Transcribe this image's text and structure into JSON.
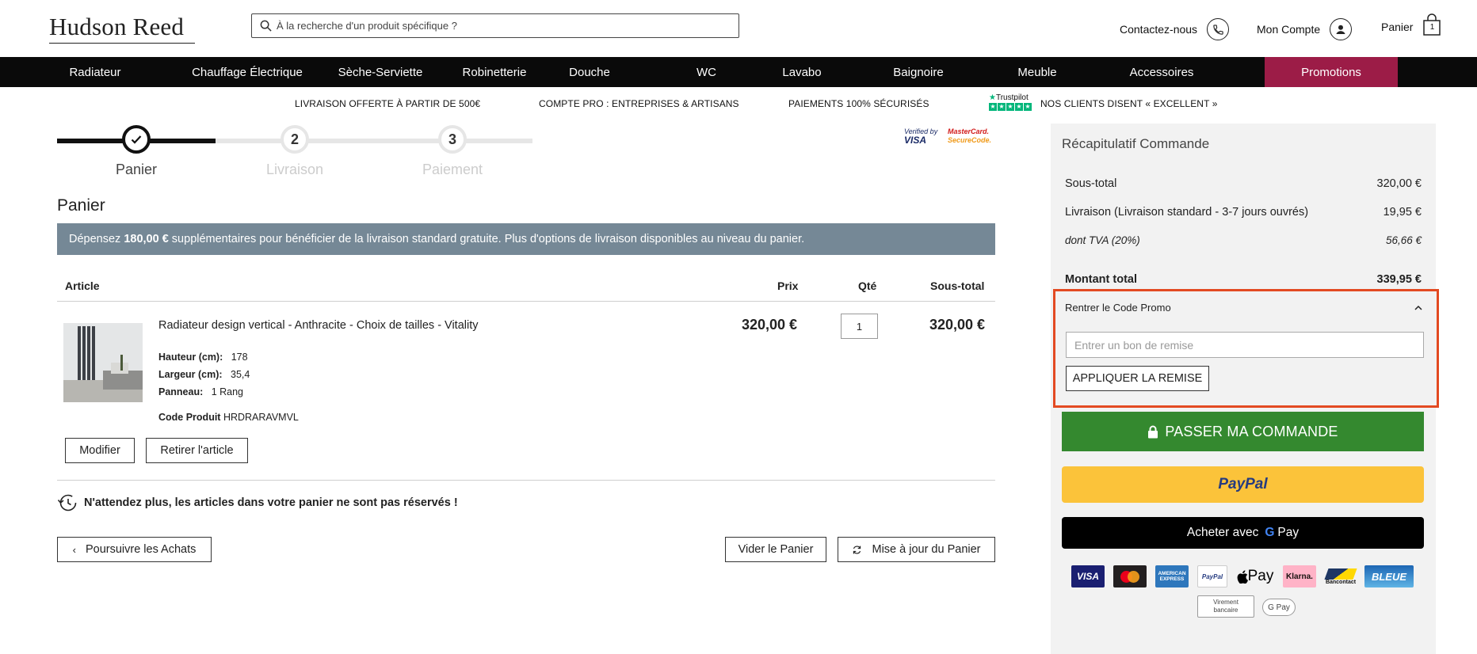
{
  "header": {
    "logo": "Hudson Reed",
    "search_placeholder": "À la recherche d'un produit spécifique ?",
    "contact_label": "Contactez-nous",
    "account_label": "Mon Compte",
    "cart_label": "Panier",
    "cart_count": "1"
  },
  "nav": {
    "items": [
      "Radiateur",
      "Chauffage Électrique",
      "Sèche-Serviette",
      "Robinetterie",
      "Douche",
      "WC",
      "Lavabo",
      "Baignoire",
      "Meuble",
      "Accessoires",
      "Promotions"
    ]
  },
  "usp": {
    "delivery": "LIVRAISON OFFERTE À PARTIR DE 500€",
    "pro": "COMPTE PRO : ENTREPRISES & ARTISANS",
    "payments": "PAIEMENTS 100% SÉCURISÉS",
    "trustpilot": "Trustpilot",
    "reviews": "NOS CLIENTS DISENT « EXCELLENT »"
  },
  "steps": [
    {
      "number": "",
      "label": "Panier"
    },
    {
      "number": "2",
      "label": "Livraison"
    },
    {
      "number": "3",
      "label": "Paiement"
    }
  ],
  "badges": {
    "verified_1": "Verified by",
    "verified_2": "VISA",
    "mc_1": "MasterCard.",
    "mc_2": "SecureCode."
  },
  "cart": {
    "title": "Panier",
    "notice_prefix": "Dépensez ",
    "notice_amount": "180,00 €",
    "notice_suffix": " supplémentaires pour bénéficier de la livraison standard gratuite. Plus d'options de livraison disponibles au niveau du panier.",
    "columns": {
      "article": "Article",
      "price": "Prix",
      "qty": "Qté",
      "subtotal": "Sous-total"
    },
    "item": {
      "name": "Radiateur design vertical - Anthracite - Choix de tailles - Vitality",
      "height_label": "Hauteur (cm):",
      "height_value": "178",
      "width_label": "Largeur (cm):",
      "width_value": "35,4",
      "panel_label": "Panneau:",
      "panel_value": "1 Rang",
      "code_label": "Code Produit",
      "code_value": "HRDRARAVMVL",
      "price": "320,00 €",
      "qty": "1",
      "subtotal": "320,00 €"
    },
    "edit_button": "Modifier",
    "remove_button": "Retirer l'article",
    "warning": "N'attendez plus, les articles dans votre panier ne sont pas réservés !",
    "continue_button": "Poursuivre les Achats",
    "empty_button": "Vider le Panier",
    "update_button": "Mise à jour du Panier"
  },
  "summary": {
    "title": "Récapitulatif Commande",
    "subtotal_label": "Sous-total",
    "subtotal_value": "320,00 €",
    "delivery_label": "Livraison (Livraison standard - 3-7 jours ouvrés)",
    "delivery_value": "19,95 €",
    "vat_label": "dont TVA (20%)",
    "vat_value": "56,66 €",
    "total_label": "Montant total",
    "total_value": "339,95 €",
    "promo_title": "Rentrer le Code Promo",
    "promo_placeholder": "Entrer un bon de remise",
    "apply_button": "APPLIQUER LA REMISE",
    "checkout_button": "PASSER MA COMMANDE",
    "paypal_button": "PayPal",
    "gpay_prefix": "Acheter avec",
    "gpay_g": "G",
    "gpay_suffix": "Pay",
    "payment_logos": [
      "VISA",
      "mastercard",
      "AMERICAN EXPRESS",
      "PayPal",
      "Pay",
      "Klarna.",
      "Bancontact",
      "BLEUE"
    ],
    "virement": "Virement bancaire",
    "gpay_small": "G Pay"
  },
  "colors": {
    "nav_bg": "#0a0a0a",
    "promo_bg": "#9c1c47",
    "notice_bg": "#758896",
    "checkout_green": "#34892f",
    "paypal_yellow": "#fbc33a",
    "highlight_border": "#e34a22"
  }
}
